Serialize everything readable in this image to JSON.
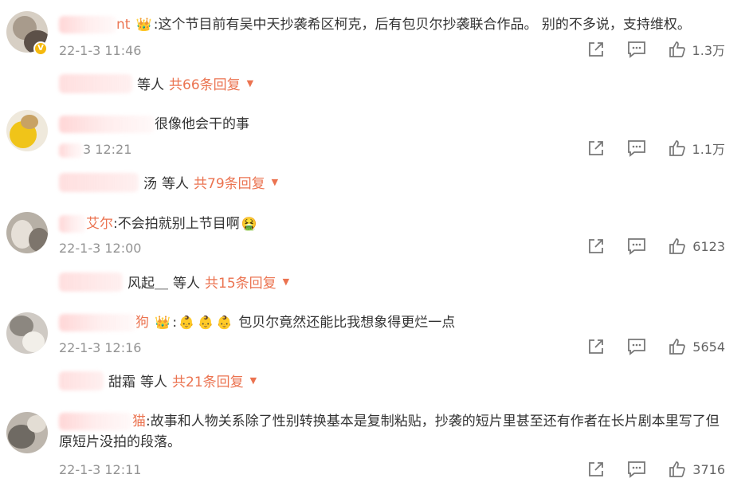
{
  "comments": [
    {
      "username_visible": "nt",
      "text": ":这个节目前有吴中天抄袭希区柯克，后有包贝尔抄袭联合作品。 别的不多说，支持维权。",
      "time": "22-1-3 11:46",
      "likes": "1.3万",
      "reply_suffix": "等人",
      "reply_count": "共66条回复",
      "verified": true
    },
    {
      "username_visible": "",
      "text": "很像他会干的事",
      "time": "3 12:21",
      "likes": "1.1万",
      "reply_names_visible": "汤",
      "reply_suffix": "等人",
      "reply_count": "共79条回复"
    },
    {
      "username_visible": "艾尔",
      "text": ":不会拍就别上节目啊",
      "time": "22-1-3 12:00",
      "likes": "6123",
      "reply_names_visible": "风起＿",
      "reply_suffix": "等人",
      "reply_count": "共15条回复"
    },
    {
      "username_visible": "狗",
      "text": "包贝尔竟然还能比我想象得更烂一点",
      "time": "22-1-3 12:16",
      "likes": "5654",
      "reply_names_visible": "甜霜",
      "reply_suffix": "等人",
      "reply_count": "共21条回复"
    },
    {
      "username_visible": "猫",
      "text": ":故事和人物关系除了性别转换基本是复制粘贴，抄袭的短片里甚至还有作者在长片剧本里写了但原短片没拍的段落。",
      "time": "22-1-3 12:11",
      "likes": "3716"
    }
  ],
  "icons": {
    "share": "share-icon",
    "comment": "comment-icon",
    "like": "thumbs-up-icon",
    "caret": "caret-down-icon",
    "verified": "verified-badge-icon"
  },
  "colors": {
    "accent": "#eb7350",
    "muted": "#939393",
    "text": "#333333"
  }
}
